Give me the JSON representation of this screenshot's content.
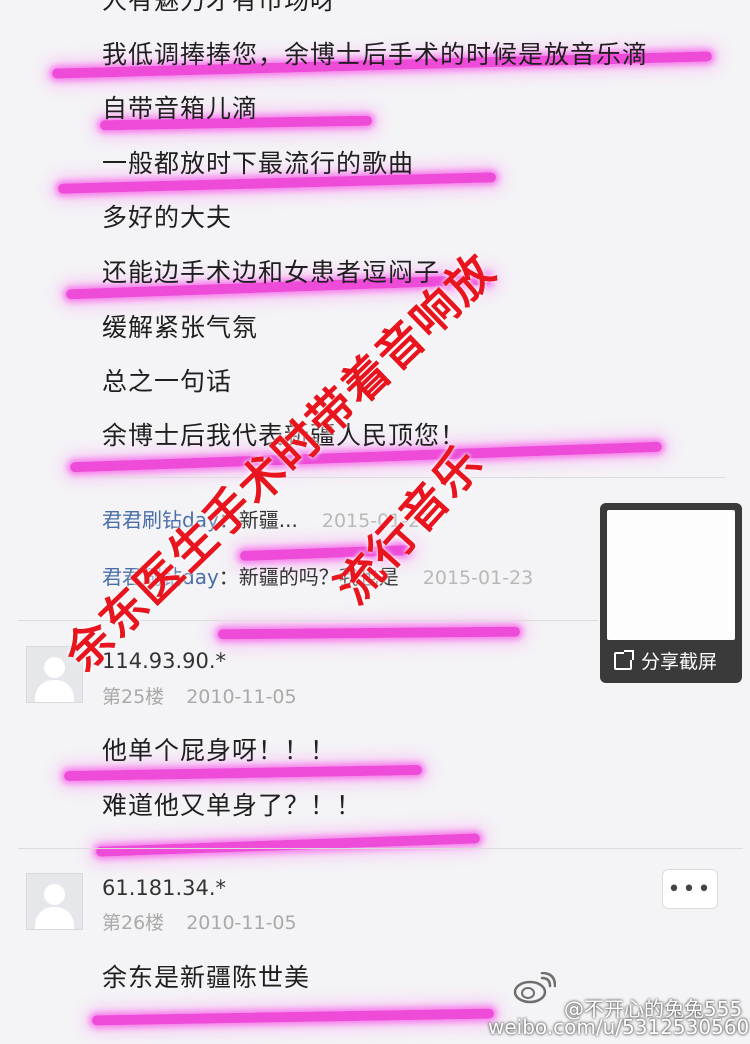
{
  "lines": [
    "人有魅力才有市场呀",
    "我低调捧捧您，余博士后手术的时候是放音乐滴",
    "自带音箱儿滴",
    "一般都放时下最流行的歌曲",
    "多好的大夫",
    "还能边手术边和女患者逗闷子",
    "缓解紧张气氛",
    "总之一句话",
    "余博士后我代表新疆人民顶您！"
  ],
  "replies": [
    {
      "user": "君君刷钻day",
      "sep": "：",
      "text": "新疆...",
      "date": "2015-01-23"
    },
    {
      "user": "君君刷钻day",
      "sep": "：",
      "text": "新疆的吗？我也是",
      "date": "2015-01-23"
    }
  ],
  "comments": [
    {
      "ip": "114.93.90.*",
      "floor": "第25楼",
      "date": "2010-11-05",
      "lines": [
        "他单个屁身呀！！！",
        "难道他又单身了？！！"
      ]
    },
    {
      "ip": "61.181.34.*",
      "floor": "第26楼",
      "date": "2010-11-05",
      "lines": [
        "余东是新疆陈世美"
      ]
    }
  ],
  "overlay": {
    "line1": "余东医生手术时带着音响放",
    "line2": "流行音乐",
    "color": "#e8141e"
  },
  "share": {
    "label": "分享截屏",
    "icon": "share-icon"
  },
  "more_button": {
    "label": "•••",
    "icon": "more-icon"
  },
  "watermark": {
    "handle": "@不开心的兔兔555",
    "url": "weibo.com/u/5312530560",
    "icon": "weibo-logo-icon"
  },
  "highlight_color": "#eb2dd2"
}
